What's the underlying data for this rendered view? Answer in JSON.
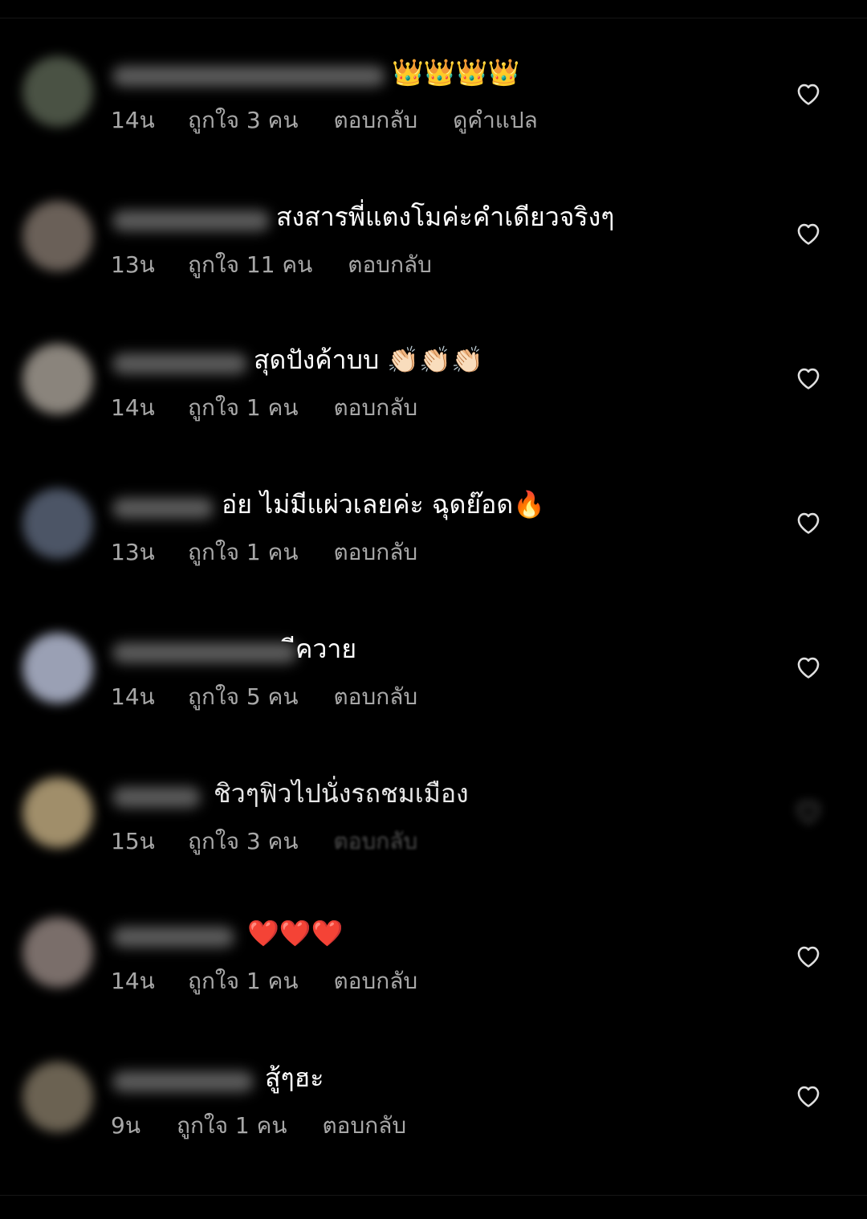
{
  "colors": {
    "background": "#000000",
    "text_primary": "#ffffff",
    "text_secondary": "#a8a8a8",
    "heart_outline": "#e0e0e0"
  },
  "comments": [
    {
      "text": "👑👑👑👑",
      "time": "14น",
      "likes": "ถูกใจ 3 คน",
      "reply": "ตอบกลับ",
      "translate": "ดูคำแปล",
      "avatar_color": "#4a5244",
      "like_icon": "heart-outline-icon"
    },
    {
      "text": "สงสารพี่แตงโมค่ะคำเดียวจริงๆ",
      "time": "13น",
      "likes": "ถูกใจ 11 คน",
      "reply": "ตอบกลับ",
      "avatar_color": "#6a6058",
      "like_icon": "heart-outline-icon"
    },
    {
      "text": "สุดปังค้าบบ 👏🏻👏🏻👏🏻",
      "time": "14น",
      "likes": "ถูกใจ 1 คน",
      "reply": "ตอบกลับ",
      "avatar_color": "#8a847c",
      "like_icon": "heart-outline-icon"
    },
    {
      "text": "อ่ย ไม่มีแผ่วเลยค่ะ ฉุดย๊อด🔥",
      "time": "13น",
      "likes": "ถูกใจ 1 คน",
      "reply": "ตอบกลับ",
      "avatar_color": "#4c5566",
      "like_icon": "heart-outline-icon"
    },
    {
      "text": "ีควาย",
      "time": "14น",
      "likes": "ถูกใจ 5 คน",
      "reply": "ตอบกลับ",
      "avatar_color": "#9aa0b4",
      "like_icon": "heart-outline-icon"
    },
    {
      "text": "ชิวๆฟิวไปนั่งรถชมเมือง",
      "time": "15น",
      "likes": "ถูกใจ 3 คน",
      "reply": "ตอบกลับ",
      "avatar_color": "#a08e6a",
      "like_icon": "heart-outline-icon"
    },
    {
      "text": "❤️❤️❤️",
      "time": "14น",
      "likes": "ถูกใจ 1 คน",
      "reply": "ตอบกลับ",
      "avatar_color": "#7a6e6a",
      "like_icon": "heart-outline-icon"
    },
    {
      "text": "สู้ๆฮะ",
      "time": "9น",
      "likes": "ถูกใจ 1 คน",
      "reply": "ตอบกลับ",
      "avatar_color": "#6b6252",
      "like_icon": "heart-outline-icon"
    }
  ]
}
